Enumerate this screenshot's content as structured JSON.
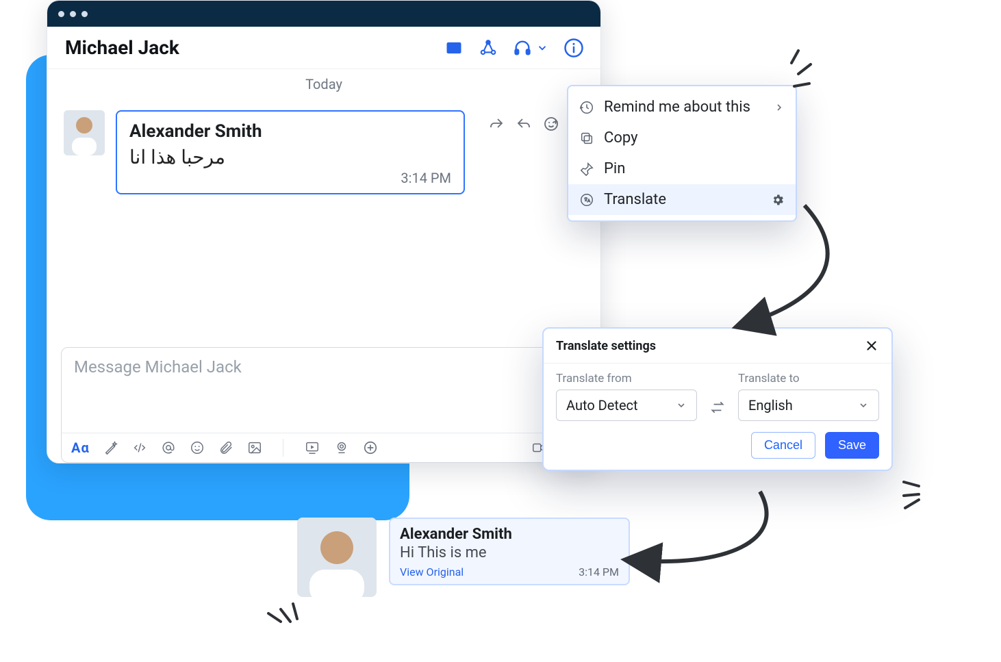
{
  "chat": {
    "title": "Michael Jack",
    "dateDivider": "Today",
    "composerPlaceholder": "Message Michael Jack",
    "message": {
      "sender": "Alexander Smith",
      "body_ar": "مرحبا هذا انا",
      "time": "3:14 PM"
    }
  },
  "contextMenu": {
    "items": [
      {
        "icon": "clock",
        "label": "Remind me about this",
        "hasSub": true
      },
      {
        "icon": "copy",
        "label": "Copy"
      },
      {
        "icon": "pin",
        "label": "Pin"
      },
      {
        "icon": "translate",
        "label": "Translate",
        "hasGear": true,
        "selected": true
      }
    ]
  },
  "settings": {
    "title": "Translate settings",
    "fromLabel": "Translate from",
    "toLabel": "Translate to",
    "fromValue": "Auto Detect",
    "toValue": "English",
    "cancel": "Cancel",
    "save": "Save"
  },
  "preview": {
    "sender": "Alexander Smith",
    "translated": "Hi This is me",
    "viewOriginal": "View Original",
    "time": "3:14 PM"
  }
}
